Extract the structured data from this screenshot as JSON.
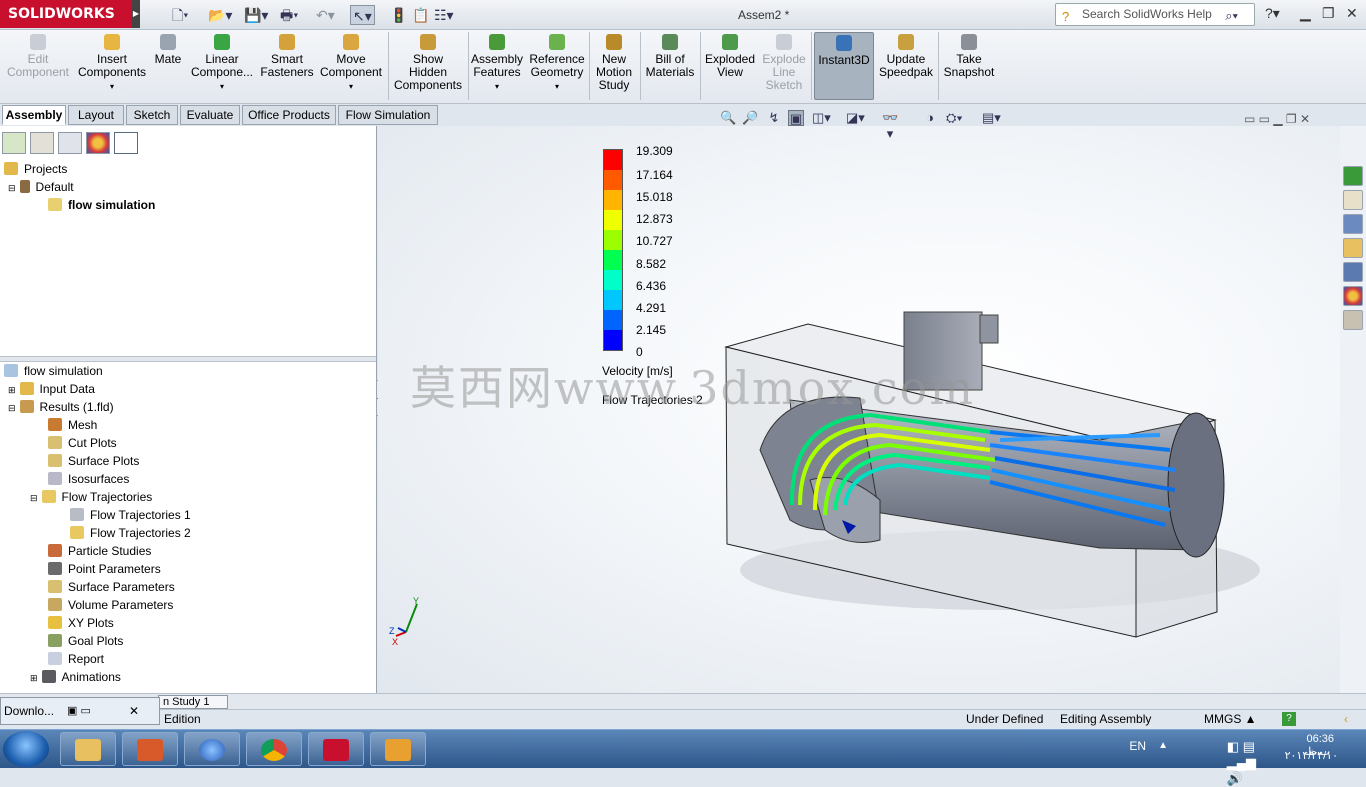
{
  "titlebar": {
    "app_logo": "SOLIDWORKS",
    "document_title": "Assem2 *",
    "search_placeholder": "Search SolidWorks Help"
  },
  "ribbon": {
    "buttons": [
      {
        "label": "Edit\nComponent",
        "enabled": false
      },
      {
        "label": "Insert\nComponents",
        "enabled": true
      },
      {
        "label": "Mate",
        "enabled": true
      },
      {
        "label": "Linear\nCompone...",
        "enabled": true
      },
      {
        "label": "Smart\nFasteners",
        "enabled": true
      },
      {
        "label": "Move\nComponent",
        "enabled": true
      },
      {
        "label": "Show\nHidden\nComponents",
        "enabled": true
      },
      {
        "label": "Assembly\nFeatures",
        "enabled": true
      },
      {
        "label": "Reference\nGeometry",
        "enabled": true
      },
      {
        "label": "New\nMotion\nStudy",
        "enabled": true
      },
      {
        "label": "Bill of\nMaterials",
        "enabled": true
      },
      {
        "label": "Exploded\nView",
        "enabled": true
      },
      {
        "label": "Explode\nLine\nSketch",
        "enabled": false
      },
      {
        "label": "Instant3D",
        "enabled": true
      },
      {
        "label": "Update\nSpeedpak",
        "enabled": true
      },
      {
        "label": "Take\nSnapshot",
        "enabled": true
      }
    ]
  },
  "tabs": [
    "Assembly",
    "Layout",
    "Sketch",
    "Evaluate",
    "Office Products",
    "Flow Simulation"
  ],
  "projects_tree": {
    "root": "Projects",
    "default": "Default",
    "project": "flow simulation"
  },
  "analysis_tree": {
    "root": "flow simulation",
    "items": [
      {
        "label": "Input Data"
      },
      {
        "label": "Results (1.fld)"
      },
      {
        "label": "Mesh"
      },
      {
        "label": "Cut Plots"
      },
      {
        "label": "Surface Plots"
      },
      {
        "label": "Isosurfaces"
      },
      {
        "label": "Flow Trajectories"
      },
      {
        "label": "Flow Trajectories 1"
      },
      {
        "label": "Flow Trajectories 2"
      },
      {
        "label": "Particle Studies"
      },
      {
        "label": "Point Parameters"
      },
      {
        "label": "Surface Parameters"
      },
      {
        "label": "Volume Parameters"
      },
      {
        "label": "XY Plots"
      },
      {
        "label": "Goal Plots"
      },
      {
        "label": "Report"
      },
      {
        "label": "Animations"
      }
    ]
  },
  "legend": {
    "values": [
      "19.309",
      "17.164",
      "15.018",
      "12.873",
      "10.727",
      "8.582",
      "6.436",
      "4.291",
      "2.145",
      "0"
    ],
    "colors": [
      "#ff0000",
      "#ff5a00",
      "#ffb400",
      "#f0ff00",
      "#9cff00",
      "#00ff50",
      "#00ffc8",
      "#00c8ff",
      "#0064ff",
      "#0000ff"
    ],
    "title": "Velocity [m/s]",
    "plot_label": "Flow Trajectories 2"
  },
  "watermark": "莫西网www.3dmox.com",
  "triad": {
    "y": "Y",
    "z": "Z",
    "x": "X"
  },
  "study_tab": "n Study 1",
  "statusbar": {
    "left": "Edition",
    "state": "Under Defined",
    "mode": "Editing Assembly",
    "units": "MMGS"
  },
  "download_popup": "Downlo...",
  "taskbar": {
    "lang": "EN",
    "time": "06:36 ب.ظ",
    "date": "۲۰۱۴/۲۴/۱۰"
  }
}
